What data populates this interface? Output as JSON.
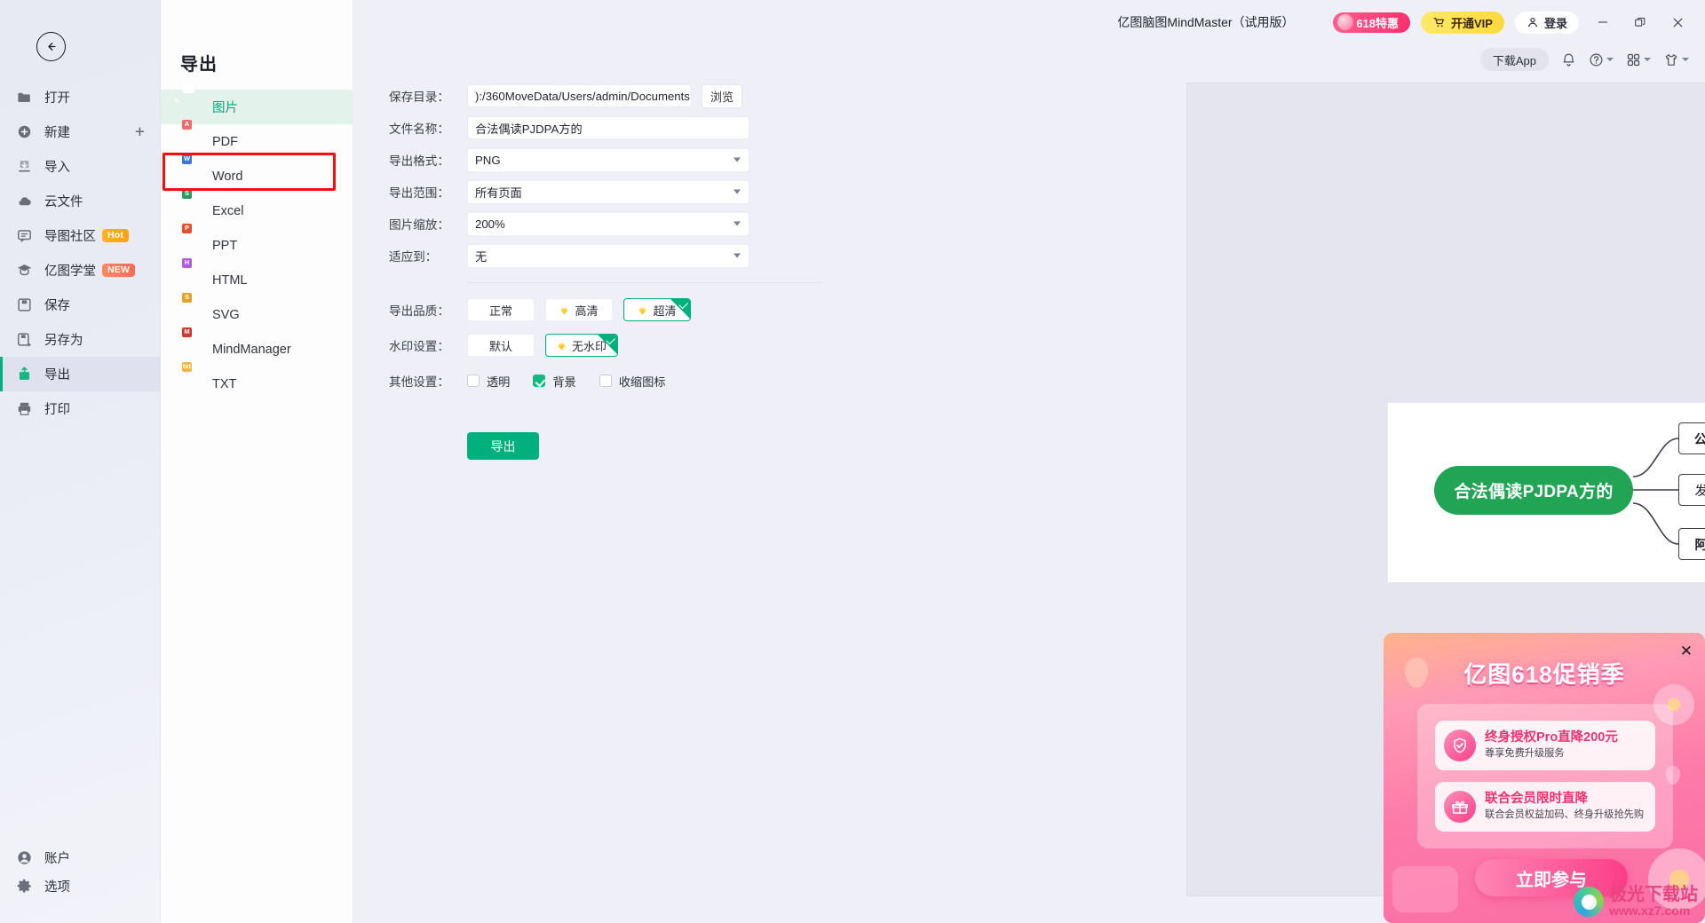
{
  "app": {
    "title": "亿图脑图MindMaster（试用版）"
  },
  "titlebar": {
    "promo_pill": "618特惠",
    "vip_button": "开通VIP",
    "login_button": "登录",
    "minimize_icon": "minimize-icon",
    "maximize_icon": "restore-icon",
    "close_icon": "close-icon"
  },
  "toolbar": {
    "download_app": "下载App",
    "bell_icon": "bell-icon",
    "help_icon": "help-icon",
    "grid_icon": "apps-grid-icon",
    "theme_icon": "theme-shirt-icon"
  },
  "leftnav": {
    "back_icon": "back-arrow-icon",
    "items": [
      {
        "label": "打开",
        "icon": "folder-icon",
        "badge": null,
        "active": false,
        "plus": false
      },
      {
        "label": "新建",
        "icon": "plus-circle-icon",
        "badge": null,
        "active": false,
        "plus": true
      },
      {
        "label": "导入",
        "icon": "import-icon",
        "badge": null,
        "active": false,
        "plus": false
      },
      {
        "label": "云文件",
        "icon": "cloud-icon",
        "badge": null,
        "active": false,
        "plus": false
      },
      {
        "label": "导图社区",
        "icon": "community-icon",
        "badge": "Hot",
        "active": false,
        "plus": false
      },
      {
        "label": "亿图学堂",
        "icon": "graduation-icon",
        "badge": "NEW",
        "active": false,
        "plus": false
      },
      {
        "label": "保存",
        "icon": "save-icon",
        "badge": null,
        "active": false,
        "plus": false
      },
      {
        "label": "另存为",
        "icon": "save-as-icon",
        "badge": null,
        "active": false,
        "plus": false
      },
      {
        "label": "导出",
        "icon": "export-icon",
        "badge": null,
        "active": true,
        "plus": false
      },
      {
        "label": "打印",
        "icon": "print-icon",
        "badge": null,
        "active": false,
        "plus": false
      }
    ],
    "bottom_items": [
      {
        "label": "账户",
        "icon": "account-icon"
      },
      {
        "label": "选项",
        "icon": "gear-icon"
      }
    ]
  },
  "export_panel": {
    "heading": "导出",
    "formats": [
      {
        "label": "图片",
        "icon": "image-file-icon",
        "tag": "",
        "color": "#4db7f0",
        "selected": true
      },
      {
        "label": "PDF",
        "icon": "pdf-file-icon",
        "tag": "A",
        "color": "#ef6b6b",
        "selected": false
      },
      {
        "label": "Word",
        "icon": "word-file-icon",
        "tag": "W",
        "color": "#3b76d8",
        "selected": false,
        "highlighted": true
      },
      {
        "label": "Excel",
        "icon": "excel-file-icon",
        "tag": "S",
        "color": "#2a9a5e",
        "selected": false
      },
      {
        "label": "PPT",
        "icon": "ppt-file-icon",
        "tag": "P",
        "color": "#e4502b",
        "selected": false
      },
      {
        "label": "HTML",
        "icon": "html-file-icon",
        "tag": "H",
        "color": "#b05ce0",
        "selected": false
      },
      {
        "label": "SVG",
        "icon": "svg-file-icon",
        "tag": "S",
        "color": "#e2a32a",
        "selected": false
      },
      {
        "label": "MindManager",
        "icon": "mindmanager-file-icon",
        "tag": "M",
        "color": "#d03a2d",
        "selected": false
      },
      {
        "label": "TXT",
        "icon": "txt-file-icon",
        "tag": "txt",
        "color": "#f0b93c",
        "selected": false
      }
    ]
  },
  "form": {
    "save_dir": {
      "label": "保存目录：",
      "value": "):/360MoveData/Users/admin/Documents",
      "browse": "浏览"
    },
    "file_name": {
      "label": "文件名称：",
      "value": "合法偶读PJDPA方的"
    },
    "export_format": {
      "label": "导出格式：",
      "value": "PNG"
    },
    "export_range": {
      "label": "导出范围：",
      "value": "所有页面"
    },
    "image_scale": {
      "label": "图片缩放：",
      "value": "200%"
    },
    "fit_to": {
      "label": "适应到：",
      "value": "无"
    },
    "quality": {
      "label": "导出品质：",
      "options": [
        {
          "text": "正常",
          "vip": false,
          "selected": false
        },
        {
          "text": "高清",
          "vip": true,
          "selected": false
        },
        {
          "text": "超清",
          "vip": true,
          "selected": true
        }
      ]
    },
    "watermark": {
      "label": "水印设置：",
      "options": [
        {
          "text": "默认",
          "vip": false,
          "selected": false
        },
        {
          "text": "无水印",
          "vip": true,
          "selected": true
        }
      ]
    },
    "other": {
      "label": "其他设置：",
      "options": [
        {
          "text": "透明",
          "checked": false
        },
        {
          "text": "背景",
          "checked": true
        },
        {
          "text": "收缩图标",
          "checked": false
        }
      ]
    },
    "submit": "导出"
  },
  "preview": {
    "mindmap": {
      "root": "合法偶读PJDPA方的",
      "branches": [
        {
          "text": "公司法我会",
          "has_note": true
        },
        {
          "text": "发哦分类管理",
          "has_note": false
        },
        {
          "text": "阿共当发送给",
          "has_note": false
        }
      ]
    }
  },
  "promo": {
    "close_icon": "close-icon",
    "title": "亿图618促销季",
    "rows": [
      {
        "icon": "shield-check-icon",
        "headline": "终身授权Pro直降200元",
        "sub": "尊享免费升级服务"
      },
      {
        "icon": "gift-icon",
        "headline": "联合会员限时直降",
        "sub": "联合会员权益加码、终身升级抢先购"
      }
    ],
    "cta": "立即参与",
    "watermark_cn": "极光下载站",
    "watermark_en": "www.xz7.com"
  },
  "colors": {
    "accent_green": "#00b07c",
    "root_node_green": "#21a453",
    "highlight_red": "#fc0d0d",
    "vip_yellow": "#ffd93d",
    "promo_pink": "#fb3d85"
  }
}
